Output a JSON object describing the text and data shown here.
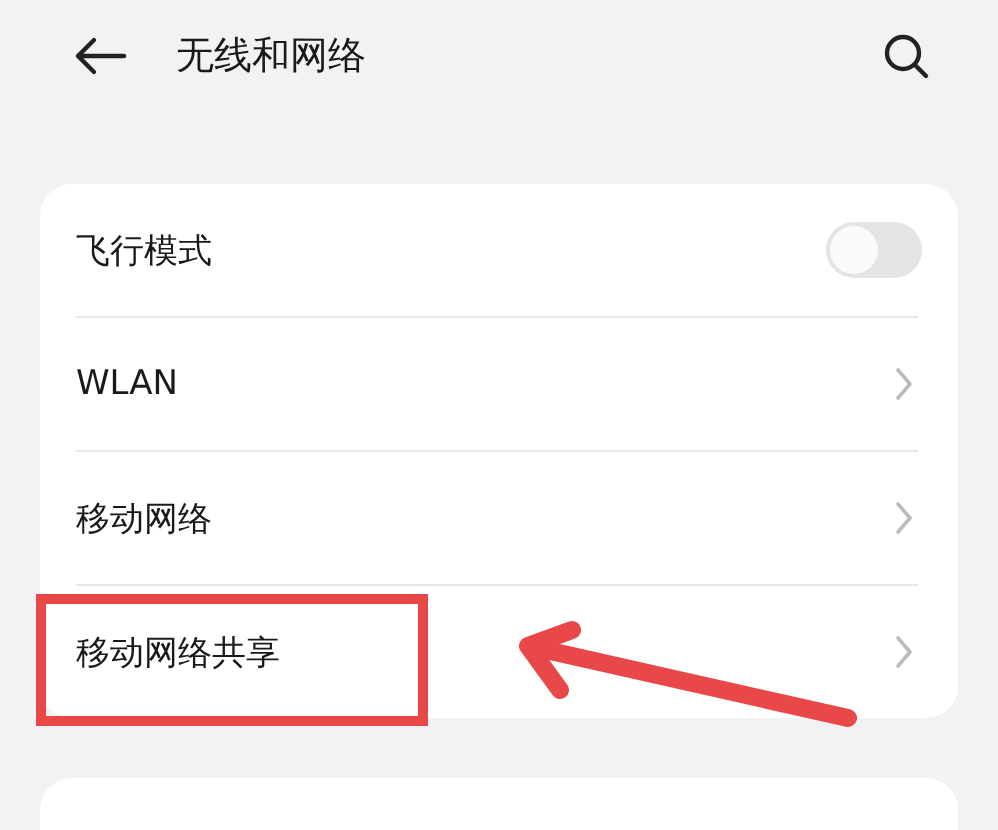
{
  "header": {
    "title": "无线和网络"
  },
  "settings": [
    {
      "kind": "toggle",
      "label": "飞行模式",
      "on": false,
      "highlighted": false
    },
    {
      "kind": "link",
      "label": "WLAN",
      "highlighted": false
    },
    {
      "kind": "link",
      "label": "移动网络",
      "highlighted": false
    },
    {
      "kind": "link",
      "label": "移动网络共享",
      "highlighted": true
    }
  ]
}
